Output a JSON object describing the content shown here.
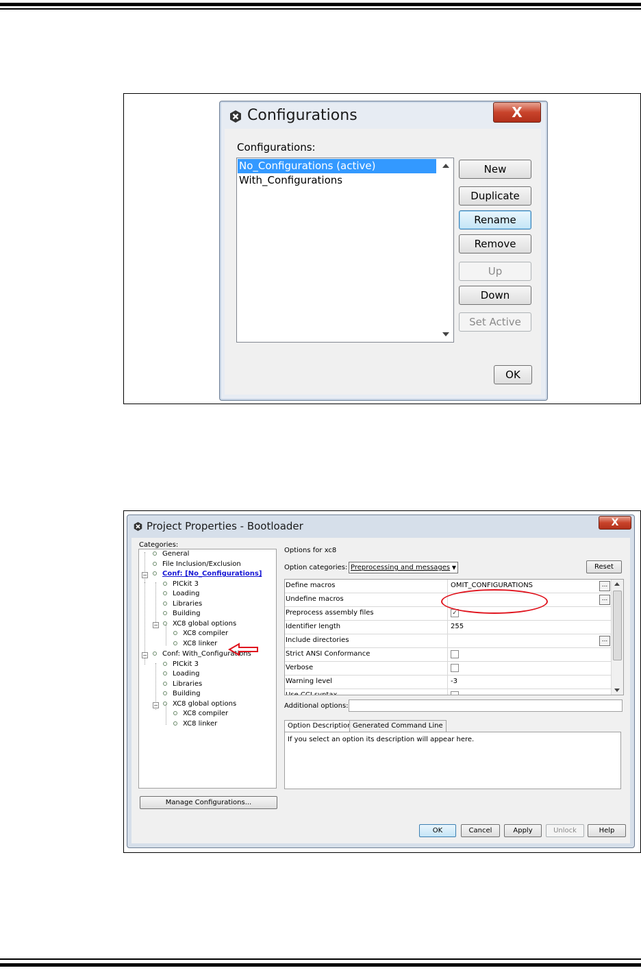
{
  "config_dialog": {
    "title": "Configurations",
    "close_label": "X",
    "list_label": "Configurations:",
    "items": [
      "No_Configurations (active)",
      "With_Configurations"
    ],
    "selected_index": 0,
    "buttons": {
      "new": "New",
      "duplicate": "Duplicate",
      "rename": "Rename",
      "remove": "Remove",
      "up": "Up",
      "down": "Down",
      "set_active": "Set Active",
      "ok": "OK"
    }
  },
  "properties_dialog": {
    "title": "Project Properties - Bootloader",
    "close_label": "X",
    "categories_label": "Categories:",
    "tree": [
      "General",
      "File Inclusion/Exclusion",
      "Conf: [No_Configurations]",
      "PICkit 3",
      "Loading",
      "Libraries",
      "Building",
      "XC8 global options",
      "XC8 compiler",
      "XC8 linker",
      "Conf: With_Configurations",
      "PICkit 3",
      "Loading",
      "Libraries",
      "Building",
      "XC8 global options",
      "XC8 compiler",
      "XC8 linker"
    ],
    "manage_button": "Manage Configurations...",
    "options_for": "Options for xc8",
    "option_categories_label": "Option categories:",
    "option_categories_value": "Preprocessing and messages",
    "reset_button": "Reset",
    "rows": [
      {
        "key": "Define macros",
        "value": "OMIT_CONFIGURATIONS"
      },
      {
        "key": "Undefine macros",
        "value": ""
      },
      {
        "key": "Preprocess assembly files",
        "value": "✓"
      },
      {
        "key": "Identifier length",
        "value": "255"
      },
      {
        "key": "Include directories",
        "value": ""
      },
      {
        "key": "Strict ANSI Conformance",
        "value": ""
      },
      {
        "key": "Verbose",
        "value": ""
      },
      {
        "key": "Warning level",
        "value": "-3"
      },
      {
        "key": "Use CCI syntax",
        "value": ""
      }
    ],
    "additional_options_label": "Additional options:",
    "tabs": [
      "Option Description",
      "Generated Command Line"
    ],
    "description": "If you select an option its description will appear here.",
    "buttons": {
      "ok": "OK",
      "cancel": "Cancel",
      "apply": "Apply",
      "unlock": "Unlock",
      "help": "Help"
    }
  },
  "colors": {
    "highlight": "#3399ff",
    "annotation_red": "#e0141e",
    "link_blue": "#1616d4"
  }
}
